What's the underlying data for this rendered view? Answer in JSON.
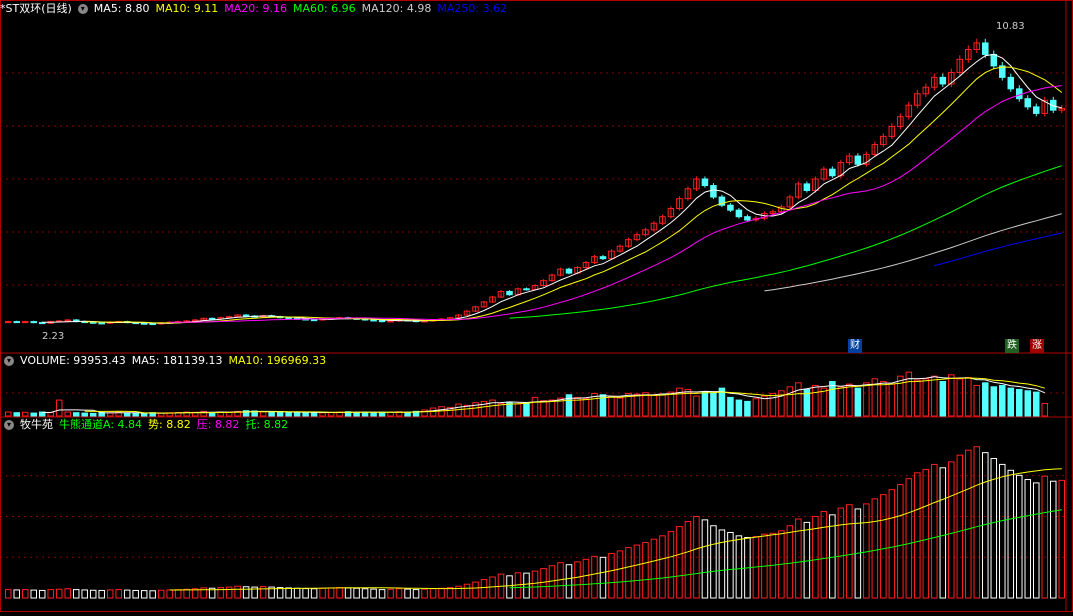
{
  "main_header": {
    "title": "*ST双环(日线)",
    "items": [
      {
        "label": "MA5: 8.80",
        "color": "#ffffff"
      },
      {
        "label": "MA10: 9.11",
        "color": "#ffff00"
      },
      {
        "label": "MA20: 9.16",
        "color": "#ff00ff"
      },
      {
        "label": "MA60: 6.96",
        "color": "#00ff00"
      },
      {
        "label": "MA120: 4.98",
        "color": "#cccccc"
      },
      {
        "label": "MA250: 3.62",
        "color": "#0000ff"
      }
    ]
  },
  "volume_header": {
    "items": [
      {
        "label": "VOLUME: 93953.43",
        "color": "#ffffff"
      },
      {
        "label": "MA5: 181139.13",
        "color": "#ffffff"
      },
      {
        "label": "MA10: 196969.33",
        "color": "#ffff00"
      }
    ]
  },
  "indicator_header": {
    "items": [
      {
        "label": "牧牛苑",
        "color": "#ffffff"
      },
      {
        "label": "牛熊通道A: 4.84",
        "color": "#00ff00"
      },
      {
        "label": "势: 8.82",
        "color": "#ffff00"
      },
      {
        "label": "压: 8.82",
        "color": "#ff00ff"
      },
      {
        "label": "托: 8.82",
        "color": "#00ff00"
      }
    ]
  },
  "annotations": {
    "high": "10.83",
    "low": "2.23",
    "tag_cai": "财",
    "tag_die": "跌",
    "tag_zhang": "涨"
  },
  "colors": {
    "up": "#ff2020",
    "down": "#54ffff",
    "grid": "#8b0000",
    "border": "#b00000"
  },
  "chart_data": {
    "type": "candlestick",
    "close": [
      2.3,
      2.28,
      2.3,
      2.27,
      2.25,
      2.3,
      2.32,
      2.35,
      2.3,
      2.28,
      2.26,
      2.25,
      2.28,
      2.3,
      2.27,
      2.25,
      2.24,
      2.23,
      2.26,
      2.28,
      2.3,
      2.32,
      2.35,
      2.4,
      2.38,
      2.42,
      2.45,
      2.5,
      2.47,
      2.45,
      2.48,
      2.45,
      2.42,
      2.4,
      2.38,
      2.36,
      2.35,
      2.38,
      2.4,
      2.42,
      2.4,
      2.38,
      2.35,
      2.33,
      2.3,
      2.32,
      2.35,
      2.33,
      2.3,
      2.32,
      2.35,
      2.38,
      2.42,
      2.5,
      2.62,
      2.75,
      2.9,
      3.05,
      3.22,
      3.12,
      3.3,
      3.28,
      3.4,
      3.55,
      3.72,
      3.9,
      3.78,
      3.95,
      4.1,
      4.28,
      4.22,
      4.45,
      4.6,
      4.8,
      4.95,
      5.1,
      5.3,
      5.5,
      5.75,
      6.05,
      6.35,
      6.65,
      6.45,
      6.1,
      5.85,
      5.7,
      5.5,
      5.4,
      5.45,
      5.6,
      5.65,
      5.8,
      6.1,
      6.5,
      6.3,
      6.65,
      6.95,
      6.75,
      7.15,
      7.35,
      7.1,
      7.4,
      7.7,
      7.95,
      8.25,
      8.55,
      8.9,
      9.25,
      9.45,
      9.75,
      9.55,
      9.9,
      10.3,
      10.6,
      10.8,
      10.45,
      10.1,
      9.75,
      9.4,
      9.1,
      8.85,
      8.65,
      9.05,
      8.75,
      8.8
    ],
    "volume": [
      30000,
      25000,
      28000,
      22000,
      30000,
      26000,
      120000,
      30000,
      25000,
      22000,
      20000,
      26000,
      24000,
      28000,
      22000,
      20000,
      18000,
      25000,
      22000,
      24000,
      26000,
      30000,
      28000,
      35000,
      26000,
      30000,
      28000,
      35000,
      40000,
      38000,
      32000,
      30000,
      28000,
      26000,
      30000,
      25000,
      28000,
      24000,
      26000,
      30000,
      32000,
      28000,
      30000,
      26000,
      28000,
      30000,
      32000,
      28000,
      35000,
      45000,
      60000,
      70000,
      65000,
      90000,
      80000,
      100000,
      110000,
      120000,
      95000,
      105000,
      90000,
      100000,
      140000,
      115000,
      120000,
      135000,
      160000,
      140000,
      130000,
      170000,
      160000,
      150000,
      135000,
      170000,
      165000,
      175000,
      155000,
      165000,
      180000,
      210000,
      200000,
      150000,
      185000,
      175000,
      210000,
      140000,
      120000,
      110000,
      130000,
      150000,
      170000,
      190000,
      220000,
      250000,
      200000,
      230000,
      210000,
      260000,
      220000,
      240000,
      210000,
      250000,
      280000,
      260000,
      240000,
      300000,
      330000,
      270000,
      280000,
      300000,
      260000,
      310000,
      280000,
      290000,
      230000,
      250000,
      220000,
      230000,
      210000,
      200000,
      190000,
      180000,
      93953
    ],
    "ylim": [
      1.8,
      11.5
    ],
    "high_label": 10.83,
    "low_label": 2.23
  }
}
